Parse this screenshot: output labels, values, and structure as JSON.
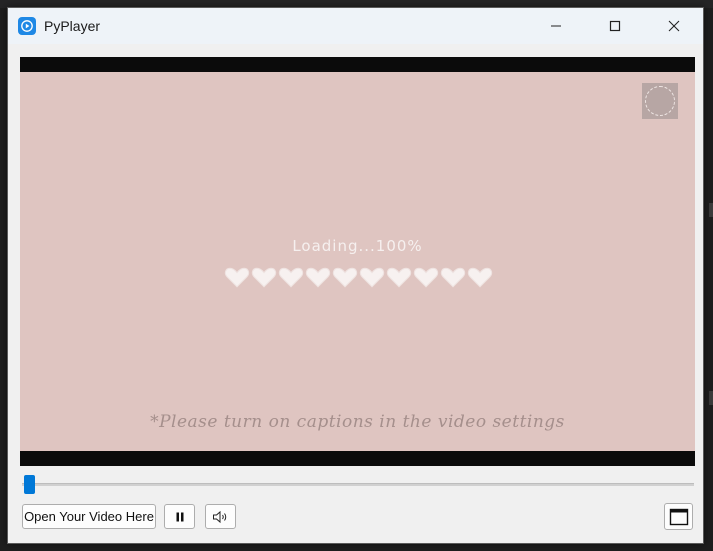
{
  "window": {
    "title": "PyPlayer"
  },
  "video": {
    "loading_text": "Loading...100%",
    "hearts_count": 10,
    "caption_text": "*Please turn on captions in the video settings",
    "frame_color": "#dfc5c1"
  },
  "seek": {
    "position": 0.0
  },
  "controls": {
    "open_label": "Open Your Video Here",
    "pause_icon": "pause-icon",
    "volume_icon": "speaker-icon",
    "fullscreen_icon": "fullscreen-icon"
  },
  "colors": {
    "accent": "#0078d7",
    "app_icon": "#1e88e5"
  }
}
